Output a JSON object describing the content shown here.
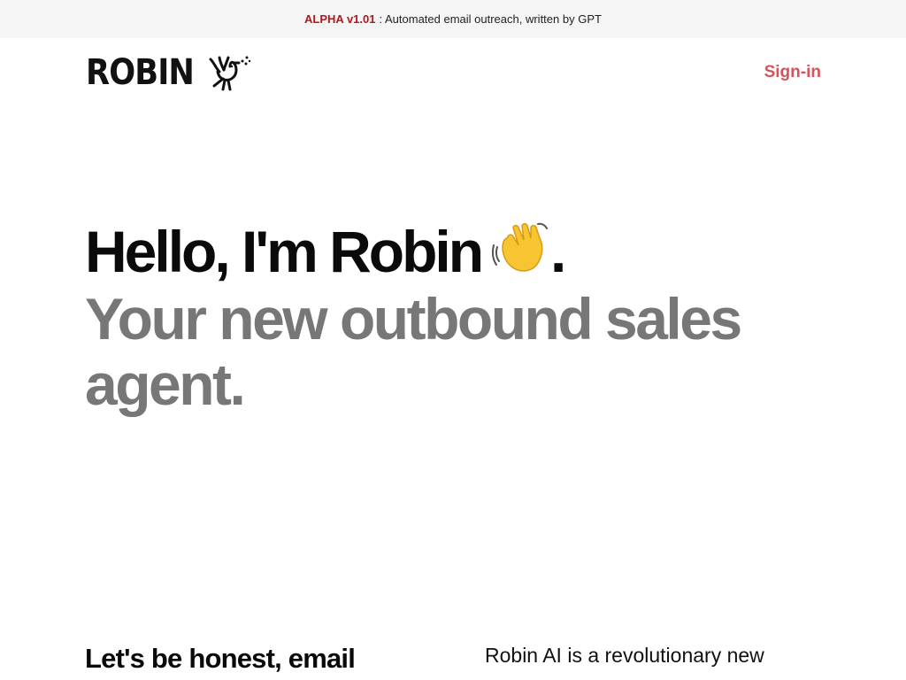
{
  "banner": {
    "version": "ALPHA v1.01",
    "text": ": Automated email outreach, written by GPT"
  },
  "header": {
    "logo_text": "ROBIN",
    "logo_icon": "bird-icon",
    "signin_label": "Sign-in"
  },
  "hero": {
    "line1": "Hello, I'm Robin",
    "line1_icon": "waving-hand-icon",
    "line1_punct": ".",
    "line2": "Your new outbound sales agent."
  },
  "sections": {
    "left_heading": "Let's be honest, email",
    "right_text": "Robin AI is a revolutionary new"
  },
  "colors": {
    "accent": "#d8525a",
    "version": "#b3161b",
    "muted_text": "#777777",
    "banner_bg": "#f5f5f5"
  }
}
